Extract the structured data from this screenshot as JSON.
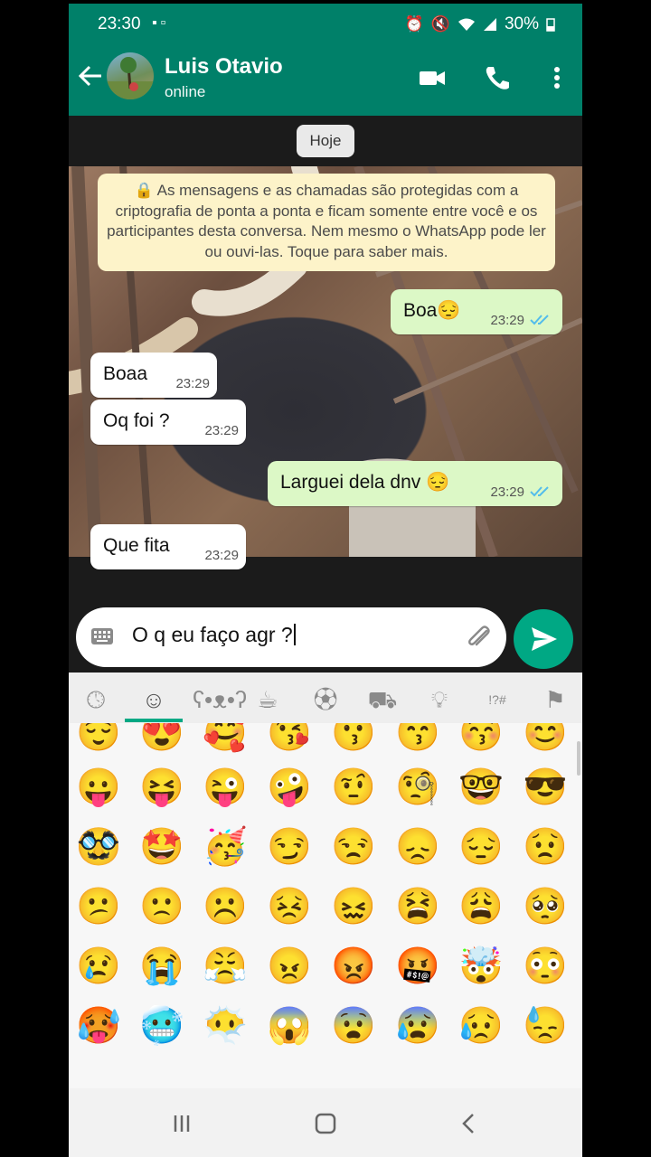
{
  "status_bar": {
    "time": "23:30",
    "battery": "30%"
  },
  "header": {
    "contact_name": "Luis Otavio",
    "status": "online"
  },
  "date_chip": "Hoje",
  "encryption_notice": "As mensagens e as chamadas são protegidas com a criptografia de ponta a ponta e ficam somente entre você e os participantes desta conversa. Nem mesmo o WhatsApp pode ler ou ouvi-las. Toque para saber mais.",
  "messages": [
    {
      "text": "Boa😔",
      "time": "23:29",
      "direction": "out"
    },
    {
      "text": "Boaa",
      "time": "23:29",
      "direction": "in"
    },
    {
      "text": "Oq foi ?",
      "time": "23:29",
      "direction": "in"
    },
    {
      "text": "Larguei dela dnv 😔",
      "time": "23:29",
      "direction": "out"
    },
    {
      "text": "Que fita",
      "time": "23:29",
      "direction": "in"
    }
  ],
  "input": {
    "value": "O q eu faço agr ?"
  },
  "emoji_tabs": [
    "clock-icon",
    "smiley-icon",
    "bear-icon",
    "cup-icon",
    "ball-icon",
    "car-icon",
    "bulb-icon",
    "symbols-icon",
    "flag-icon"
  ],
  "emoji_rows": [
    [
      "😌",
      "😍",
      "🥰",
      "😘",
      "😗",
      "😙",
      "😚",
      "😊"
    ],
    [
      "😛",
      "😝",
      "😜",
      "🤪",
      "🤨",
      "🧐",
      "🤓",
      "😎"
    ],
    [
      "🥸",
      "🤩",
      "🥳",
      "😏",
      "😒",
      "😞",
      "😔",
      "😟"
    ],
    [
      "😕",
      "🙁",
      "☹️",
      "😣",
      "😖",
      "😫",
      "😩",
      "🥺"
    ],
    [
      "😢",
      "😭",
      "😤",
      "😠",
      "😡",
      "🤬",
      "🤯",
      "😳"
    ],
    [
      "🥵",
      "🥶",
      "😶‍🌫️",
      "😱",
      "😨",
      "😰",
      "😥",
      "😓"
    ]
  ],
  "colors": {
    "header": "#008069",
    "accent": "#00a884",
    "outgoing_bubble": "#dcf8c6",
    "read_ticks": "#53bdeb"
  }
}
